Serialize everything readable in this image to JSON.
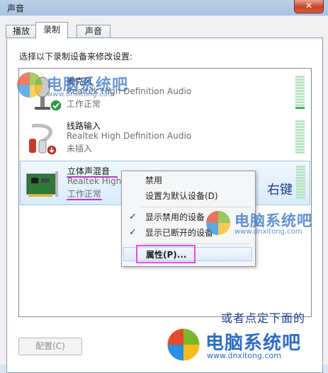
{
  "window": {
    "title": "声音"
  },
  "tabs": [
    {
      "label": "播放"
    },
    {
      "label": "录制"
    },
    {
      "label": "声音"
    }
  ],
  "instruction": "选择以下录制设备来修改设置:",
  "devices": [
    {
      "name": "麦克风",
      "driver": "Realtek High Definition Audio",
      "status": "工作正常",
      "badge": "check-badge-icon",
      "level": 0.1
    },
    {
      "name": "线路输入",
      "driver": "Realtek High Definition Audio",
      "status": "未插入",
      "badge": "down-arrow-badge-icon",
      "level": 0
    },
    {
      "name": "立体声混音",
      "driver": "Realtek High",
      "status": "工作正常",
      "badge": "",
      "level": 0
    }
  ],
  "context_menu": {
    "items": [
      {
        "label": "禁用",
        "checked": false
      },
      {
        "label": "设置为默认设备(D)",
        "checked": false
      },
      {
        "label": "显示禁用的设备",
        "checked": true
      },
      {
        "label": "显示已断开的设备",
        "checked": true
      },
      {
        "label": "属性(P)...",
        "checked": false
      }
    ]
  },
  "annotations": {
    "right_click": "右键",
    "or_click_below": "或者点定下面的"
  },
  "buttons": {
    "configure": "配置(C)"
  },
  "watermark": {
    "brand": "电脑系统吧",
    "url": "www.dnxitong.com"
  },
  "colors": {
    "highlight": "#ee49e6",
    "meter_active": "#4aaa5e",
    "meter_idle": "#b7e3c4"
  }
}
